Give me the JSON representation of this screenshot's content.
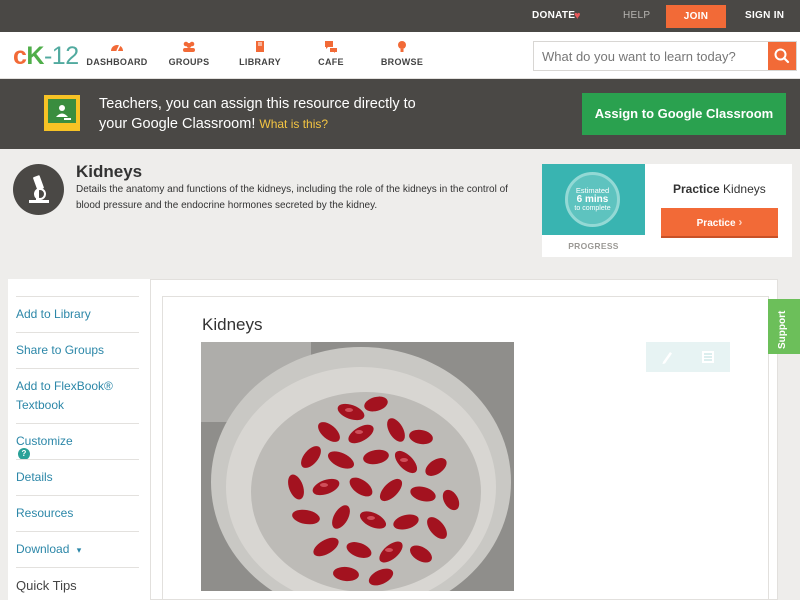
{
  "topbar": {
    "donate": "DONATE",
    "help": "HELP",
    "join": "JOIN",
    "signin": "SIGN IN"
  },
  "nav": {
    "logo": {
      "c": "c",
      "k": "K",
      "dash": "-",
      "num": "12"
    },
    "items": [
      {
        "label": "DASHBOARD",
        "icon": "dashboard-icon"
      },
      {
        "label": "GROUPS",
        "icon": "groups-icon"
      },
      {
        "label": "LIBRARY",
        "icon": "library-icon"
      },
      {
        "label": "CAFE",
        "icon": "cafe-icon"
      },
      {
        "label": "BROWSE",
        "icon": "browse-icon"
      }
    ],
    "search_placeholder": "What do you want to learn today?"
  },
  "banner": {
    "line1": "Teachers, you can assign this resource directly to",
    "line2": "your Google Classroom!",
    "what_link": "What is this?",
    "assign_button": "Assign to Google Classroom"
  },
  "header": {
    "title": "Kidneys",
    "description": "Details the anatomy and functions of the kidneys, including the role of the kidneys in the control of blood pressure and the endocrine hormones secreted by the kidney."
  },
  "practice": {
    "estimated": "Estimated",
    "mins": "6 mins",
    "to_complete": "to complete",
    "progress_label": "PROGRESS",
    "heading_bold": "Practice",
    "heading_rest": "Kidneys",
    "button": "Practice"
  },
  "sidebar": {
    "items": [
      {
        "label": "Add to Library"
      },
      {
        "label": "Share to Groups"
      },
      {
        "label": "Add to FlexBook®"
      },
      {
        "label": "Textbook"
      },
      {
        "label": "Customize"
      },
      {
        "label": "Details"
      },
      {
        "label": "Resources"
      },
      {
        "label": "Download"
      },
      {
        "label": "Quick Tips"
      }
    ],
    "help_badge": "?",
    "download_caret": "▾"
  },
  "content": {
    "title": "Kidneys"
  },
  "support": "Support",
  "colors": {
    "brand_orange": "#f26a37",
    "classroom_green": "#2aa14f",
    "teal": "#39b4b1",
    "link_blue": "#2c87a8",
    "dark_bar": "#4a4845"
  }
}
